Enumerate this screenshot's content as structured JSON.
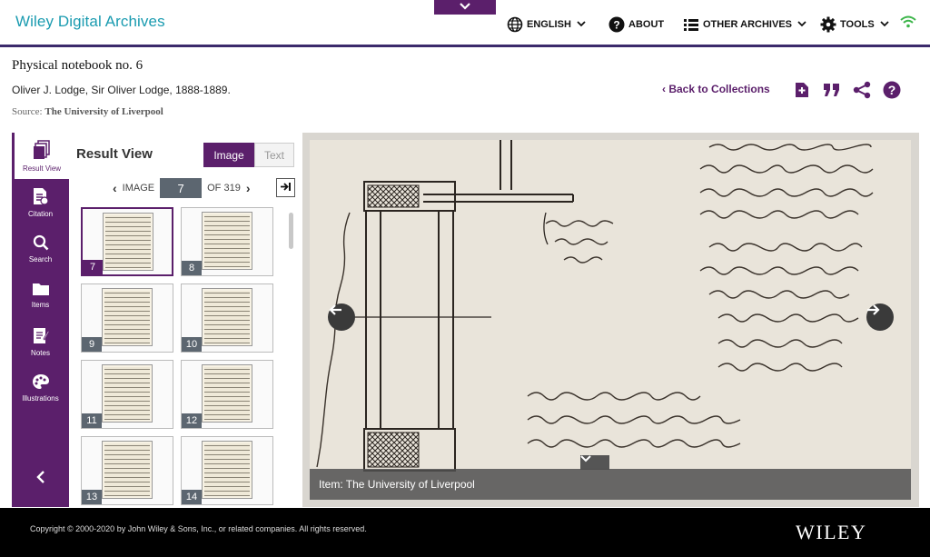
{
  "header": {
    "brand": "Wiley Digital Archives",
    "drop_tab_icon": "chevron-down-icon",
    "nav": [
      {
        "label": "ENGLISH",
        "icon": "globe-icon"
      },
      {
        "label": "ABOUT",
        "icon": "help-circle-icon"
      },
      {
        "label": "OTHER ARCHIVES",
        "icon": "list-icon"
      },
      {
        "label": "TOOLS",
        "icon": "gear-icon"
      }
    ],
    "signal_icon": "wifi-icon"
  },
  "document": {
    "title": "Physical notebook no. 6",
    "author": "Oliver J. Lodge, Sir Oliver Lodge, 1888-1889.",
    "source_label": "Source:",
    "source_value": "The University of Liverpool",
    "back_link": "Back to Collections",
    "action_icons": [
      "add-document-icon",
      "quote-icon",
      "share-icon",
      "help-icon"
    ]
  },
  "sidebar": {
    "items": [
      {
        "label": "Result View",
        "icon": "pages-icon",
        "active": true
      },
      {
        "label": "Citation",
        "icon": "citation-icon",
        "active": false
      },
      {
        "label": "Search",
        "icon": "search-icon",
        "active": false
      },
      {
        "label": "Items",
        "icon": "folder-icon",
        "active": false
      },
      {
        "label": "Notes",
        "icon": "notes-icon",
        "active": false
      },
      {
        "label": "Illustrations",
        "icon": "palette-icon",
        "active": false
      }
    ],
    "collapse_icon": "chevron-left-icon"
  },
  "results": {
    "title": "Result View",
    "toggle_image": "Image",
    "toggle_text": "Text",
    "pager_prefix": "IMAGE",
    "current_image": "7",
    "pager_of": "OF 319",
    "thumbnails": [
      "7",
      "8",
      "9",
      "10",
      "11",
      "12",
      "13",
      "14"
    ],
    "selected": "7"
  },
  "viewer": {
    "caption": "Item: The University of Liverpool",
    "prev_icon": "arrow-left-icon",
    "next_icon": "arrow-right-icon"
  },
  "footer": {
    "copyright": "Copyright © 2000-2020 by John Wiley & Sons, Inc., or related companies. All rights reserved.",
    "logo": "WILEY"
  },
  "colors": {
    "brand_teal": "#1a9bb0",
    "accent_purple": "#5b1f6b",
    "paper": "#e9e4da"
  }
}
